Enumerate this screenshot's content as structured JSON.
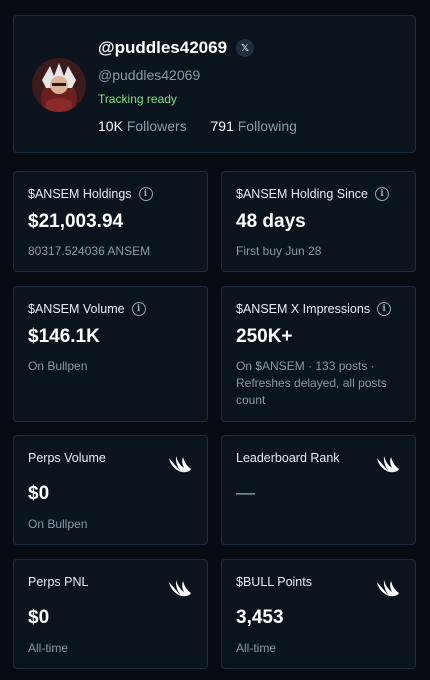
{
  "profile": {
    "display_handle": "@puddles42069",
    "x_badge": "𝕏",
    "handle": "@puddles42069",
    "status": "Tracking ready",
    "followers_count": "10K",
    "followers_label": "Followers",
    "following_count": "791",
    "following_label": "Following"
  },
  "cards": {
    "holdings": {
      "label": "$ANSEM Holdings",
      "value": "$21,003.94",
      "sub": "80317.524036 ANSEM"
    },
    "holding_since": {
      "label": "$ANSEM Holding Since",
      "value": "48 days",
      "sub": "First buy Jun 28"
    },
    "volume": {
      "label": "$ANSEM Volume",
      "value": "$146.1K",
      "sub": "On Bullpen"
    },
    "impressions": {
      "label": "$ANSEM X Impressions",
      "value": "250K+",
      "sub": "On $ANSEM · 133 posts · Refreshes delayed, all posts count"
    },
    "perps_volume": {
      "label": "Perps Volume",
      "value": "$0",
      "sub": "On Bullpen"
    },
    "leaderboard": {
      "label": "Leaderboard Rank",
      "value": "—"
    },
    "perps_pnl": {
      "label": "Perps PNL",
      "value": "$0",
      "sub": "All-time"
    },
    "bull_points": {
      "label": "$BULL Points",
      "value": "3,453",
      "sub": "All-time"
    }
  },
  "icons": {
    "info": "info-icon",
    "wing": "bullpen-wing-icon",
    "x": "x-logo-icon"
  },
  "colors": {
    "background": "#070c12",
    "card": "#0b131c",
    "border": "#1e2c3b",
    "status": "#7ee08a",
    "muted": "#8b98a6"
  }
}
